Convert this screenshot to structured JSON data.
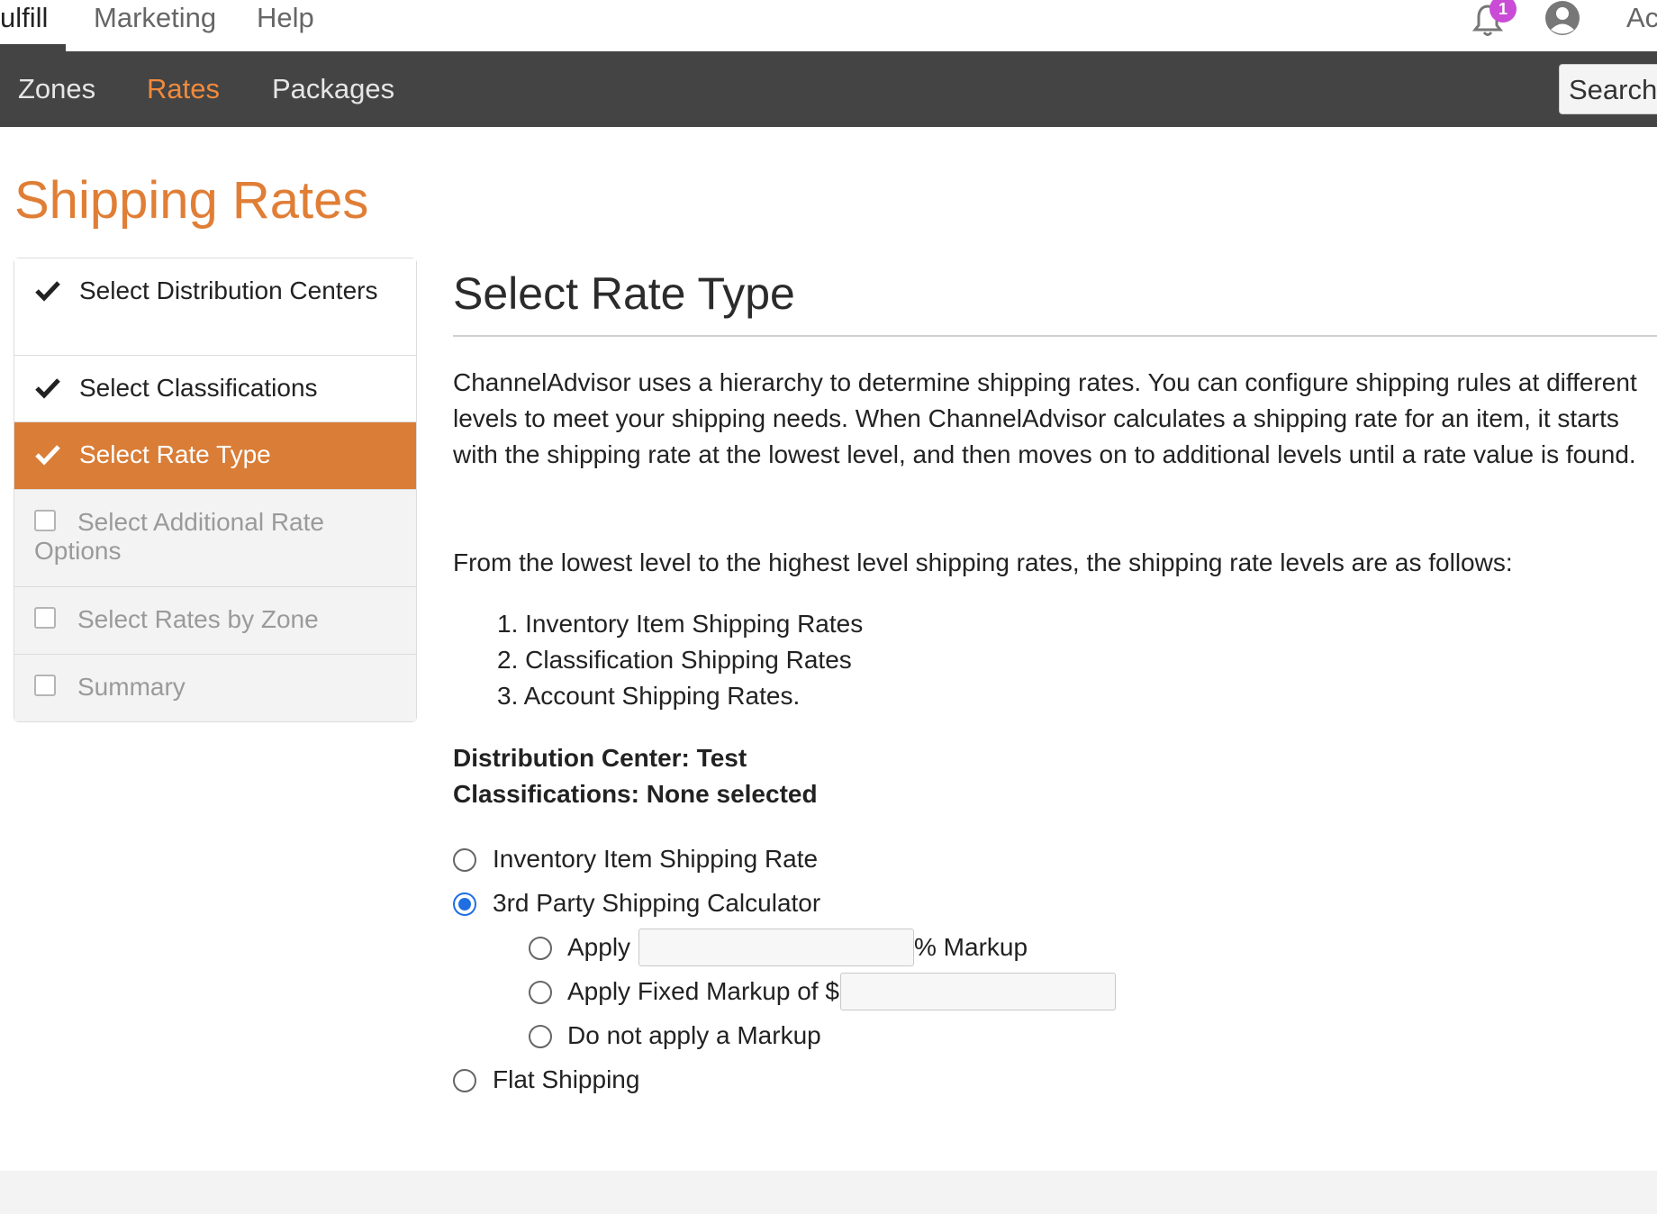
{
  "top_nav": {
    "items": [
      "ulfill",
      "Marketing",
      "Help"
    ],
    "notification_count": "1",
    "account_label": "Ac"
  },
  "sub_nav": {
    "tabs": [
      "Zones",
      "Rates",
      "Packages"
    ],
    "active_tab": "Rates",
    "search_label": "Search"
  },
  "page": {
    "title": "Shipping Rates"
  },
  "wizard_steps": [
    {
      "label": "Select Distribution Centers",
      "status": "done"
    },
    {
      "label": "Select Classifications",
      "status": "done"
    },
    {
      "label": "Select Rate Type",
      "status": "current"
    },
    {
      "label": "Select Additional Rate Options",
      "status": "todo"
    },
    {
      "label": "Select Rates by Zone",
      "status": "todo"
    },
    {
      "label": "Summary",
      "status": "todo"
    }
  ],
  "main": {
    "heading": "Select Rate Type",
    "intro": "ChannelAdvisor uses a hierarchy to determine shipping rates. You can configure shipping rules at different levels to meet your shipping needs. When ChannelAdvisor calculates a shipping rate for an item, it starts with the shipping rate at the lowest level, and then moves on to additional levels until a rate value is found.",
    "levels_intro": "From the lowest level to the highest level shipping rates, the shipping rate levels are as follows:",
    "levels": [
      "1. Inventory Item Shipping Rates",
      "2. Classification Shipping Rates",
      "3. Account Shipping Rates."
    ],
    "distribution_center": "Distribution Center: Test",
    "classifications": "Classifications: None selected",
    "rate_options": {
      "inventory": "Inventory Item Shipping Rate",
      "third_party": "3rd Party Shipping Calculator",
      "apply": "Apply",
      "percent_markup": "% Markup",
      "percent_value": "",
      "fixed_markup": "Apply Fixed Markup of $",
      "fixed_value": "",
      "no_markup": "Do not apply a Markup",
      "flat": "Flat Shipping",
      "selected": "3rd Party Shipping Calculator"
    }
  },
  "colors": {
    "accent": "#e07e36",
    "step_active_bg": "#d97d37",
    "subnav_bg": "#444444",
    "radio_checked": "#1f6fe3",
    "badge": "#c94bd6"
  }
}
